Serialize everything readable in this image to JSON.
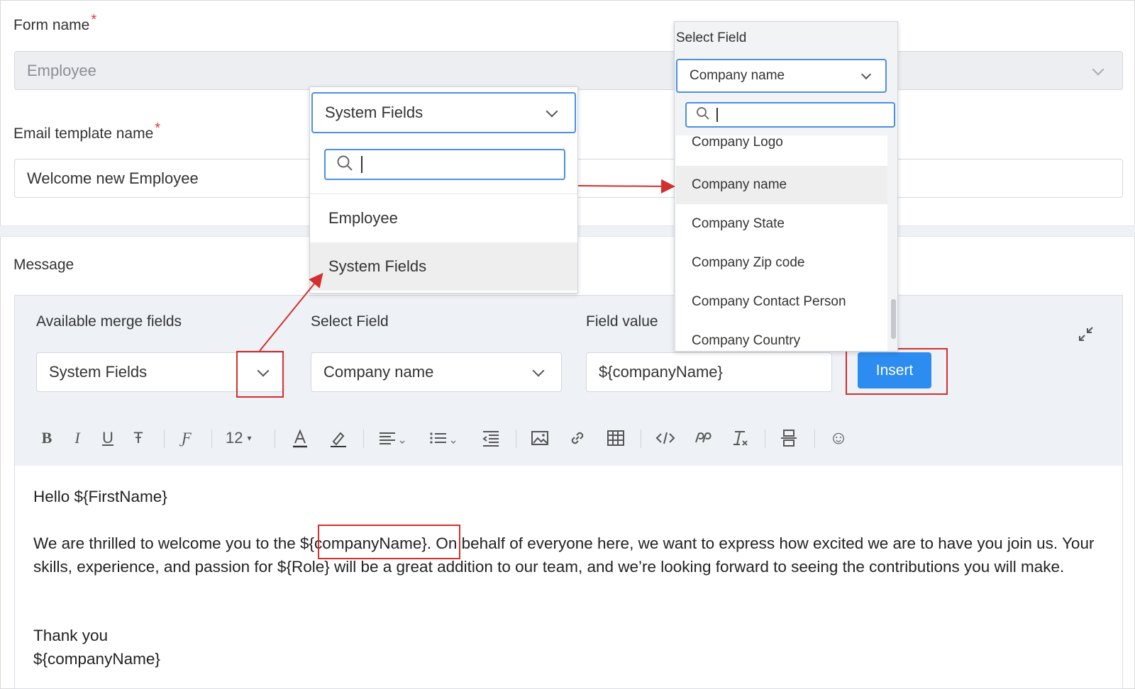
{
  "form": {
    "form_name_label": "Form name",
    "form_name_value": "Employee",
    "template_name_label": "Email template name",
    "template_name_value": "Welcome new Employee",
    "required_mark": "*"
  },
  "message": {
    "label": "Message"
  },
  "merge": {
    "available_label": "Available merge fields",
    "available_value": "System Fields",
    "select_field_label": "Select Field",
    "select_field_value": "Company name",
    "field_value_label": "Field value",
    "field_value": "${companyName}",
    "insert_label": "Insert"
  },
  "toolbar": {
    "bold": "B",
    "italic": "I",
    "underline": "U",
    "strike": "Ŧ",
    "font": "Ƒ",
    "font_size": "12",
    "emoji": "☺"
  },
  "editor_body": {
    "line1": "Hello ${FirstName}",
    "para_a": "We are thrilled to welcome you to the ",
    "para_token": "${companyName}",
    "para_b": ". On behalf of everyone here, we want to express how excited we are to have you join us. Your skills, experience, and passion for ${Role} will be a great addition to our team, and we’re looking forward to seeing the contributions you will make.",
    "thanks": "Thank you",
    "sign": "${companyName}"
  },
  "dropdown_category": {
    "selected": "System Fields",
    "items": [
      "Employee",
      "System Fields"
    ]
  },
  "dropdown_field": {
    "title": "Select Field",
    "selected": "Company name",
    "items": [
      "Company Logo",
      "Company name",
      "Company State",
      "Company Zip code",
      "Company Contact Person",
      "Company Country"
    ]
  },
  "colors": {
    "accent": "#2d8cf0",
    "annotation_red": "#d32f2f",
    "required": "#e53935"
  }
}
